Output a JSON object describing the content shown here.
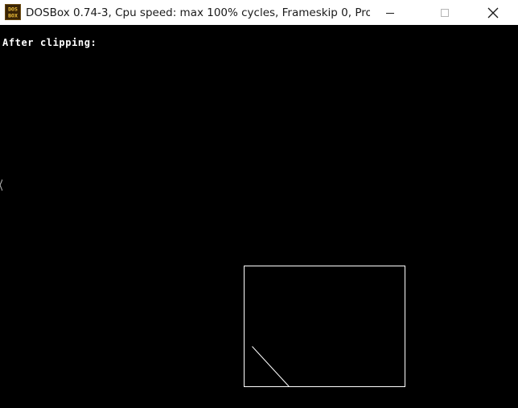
{
  "window": {
    "title": "DOSBox 0.74-3, Cpu speed: max 100% cycles, Frameskip  0, Pro...",
    "icon": "dosbox-icon",
    "icon_text_top": "DOS",
    "icon_text_bottom": "BOX",
    "controls": {
      "minimize_icon": "minimize-icon",
      "maximize_icon": "maximize-icon",
      "close_icon": "close-icon"
    }
  },
  "screen": {
    "message": "After clipping:",
    "background_color": "#000000",
    "foreground_color": "#ffffff"
  }
}
